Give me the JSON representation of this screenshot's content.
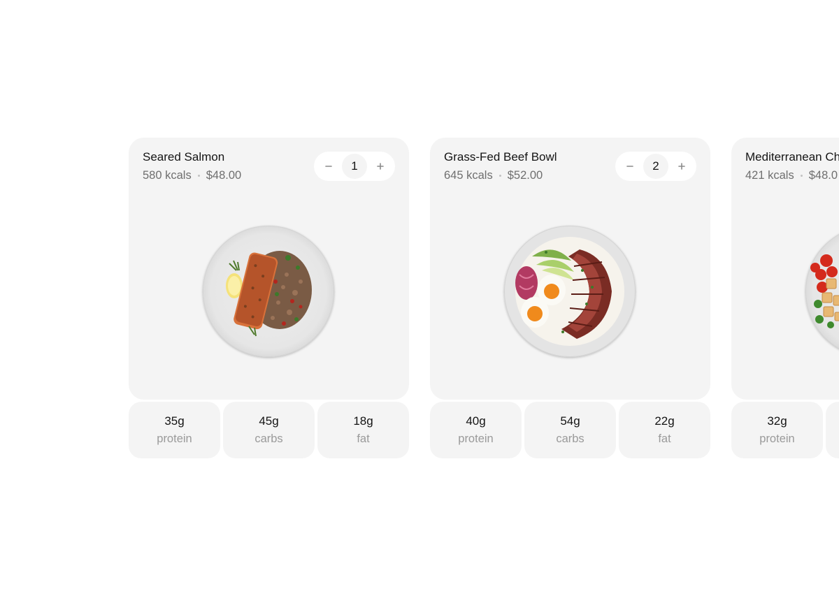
{
  "meals": [
    {
      "name": "Seared Salmon",
      "kcals": "580 kcals",
      "price": "$48.00",
      "quantity": "1",
      "image_icon": "salmon-quinoa-plate-icon",
      "stats": [
        {
          "value": "35g",
          "label": "protein"
        },
        {
          "value": "45g",
          "label": "carbs"
        },
        {
          "value": "18g",
          "label": "fat"
        }
      ]
    },
    {
      "name": "Grass-Fed Beef Bowl",
      "kcals": "645 kcals",
      "price": "$52.00",
      "quantity": "2",
      "image_icon": "beef-rice-bowl-icon",
      "stats": [
        {
          "value": "40g",
          "label": "protein"
        },
        {
          "value": "54g",
          "label": "carbs"
        },
        {
          "value": "22g",
          "label": "fat"
        }
      ]
    },
    {
      "name": "Mediterranean Ch",
      "kcals": "421 kcals",
      "price": "$48.0",
      "image_icon": "mediterranean-chicken-plate-icon",
      "stats": [
        {
          "value": "32g",
          "label": "protein"
        }
      ]
    }
  ],
  "colors": {
    "card_bg": "#f4f4f4",
    "text_primary": "#141414",
    "text_secondary": "#6f6f6f",
    "text_muted": "#9a9a9a"
  }
}
